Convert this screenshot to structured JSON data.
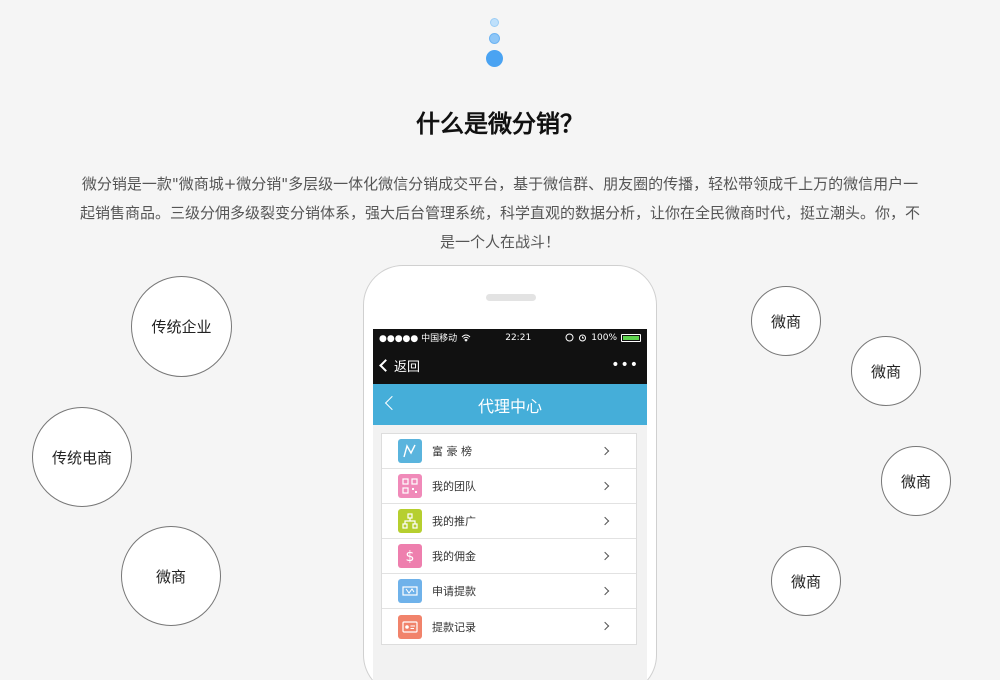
{
  "title": "什么是微分销？",
  "description": {
    "line1": "微分销是一款\"微商城+微分销\"多层级一体化微信分销成交平台，基于微信群、朋友圈的传播，轻松带领成千上万的微信用户一",
    "line2": "起销售商品。三级分佣多级裂变分销体系，强大后台管理系统，科学直观的数据分析，让你在全民微商时代，挺立潮头。你，不",
    "line3": "是一个人在战斗！"
  },
  "left_circles": [
    "传统企业",
    "传统电商",
    "微商"
  ],
  "right_circles": [
    "微商",
    "微商",
    "微商",
    "微商"
  ],
  "phone": {
    "status": {
      "carrier": "●●●●● 中国移动",
      "time": "22:21",
      "battery": "100%"
    },
    "nav": {
      "back_label": "返回",
      "more": "•••"
    },
    "header_title": "代理中心",
    "menu": [
      {
        "label": "富 豪 榜",
        "icon": "chart-icon",
        "color": "#5ab4dd"
      },
      {
        "label": "我的团队",
        "icon": "qrcode-icon",
        "color": "#f08ab9"
      },
      {
        "label": "我的推广",
        "icon": "hierarchy-icon",
        "color": "#b6cf2f"
      },
      {
        "label": "我的佣金",
        "icon": "dollar-icon",
        "color": "#ee7fae"
      },
      {
        "label": "申请提款",
        "icon": "ticket-icon",
        "color": "#6fb2ea"
      },
      {
        "label": "提款记录",
        "icon": "card-icon",
        "color": "#f1836b"
      }
    ]
  }
}
